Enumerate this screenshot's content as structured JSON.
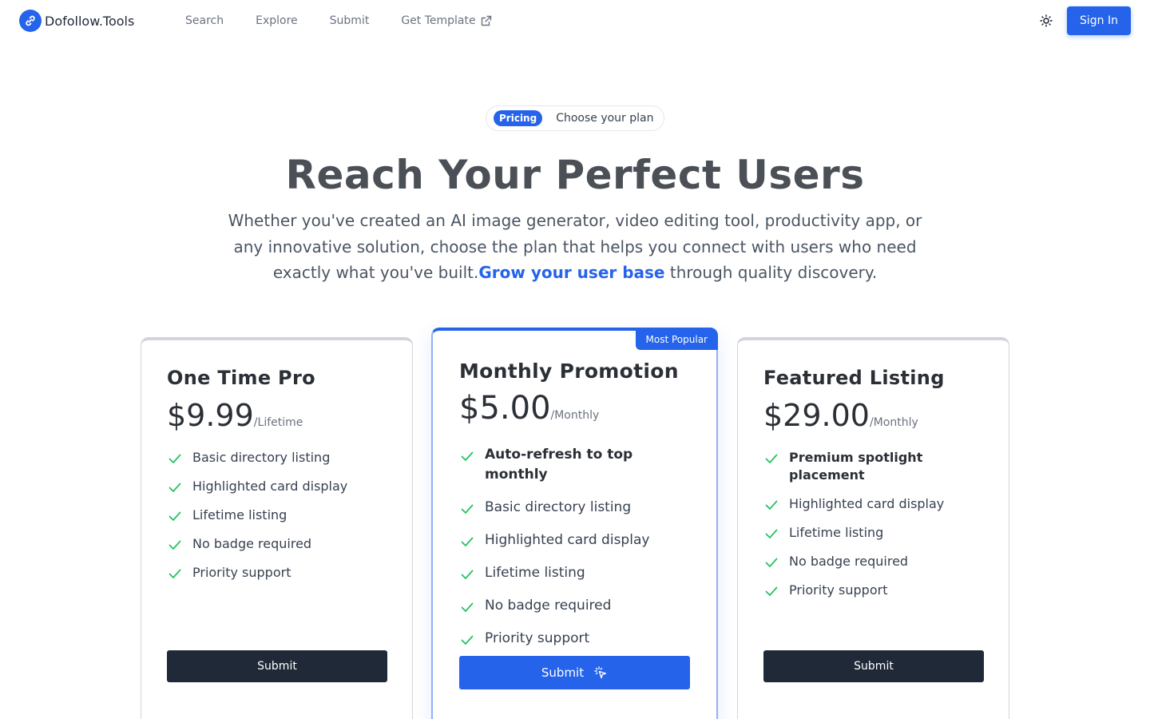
{
  "header": {
    "logo_text": "Dofollow.Tools",
    "nav": [
      {
        "label": "Search"
      },
      {
        "label": "Explore"
      },
      {
        "label": "Submit"
      },
      {
        "label": "Get Template",
        "icon": "external-link-icon"
      }
    ],
    "theme_icon": "sun-icon",
    "signin_label": "Sign In"
  },
  "hero": {
    "pill_badge": "Pricing",
    "pill_text": "Choose your plan",
    "title": "Reach Your Perfect Users",
    "subtitle_before": "Whether you've created an AI image generator, video editing tool, productivity app, or any innovative solution, choose the plan that helps you connect with users who need exactly what you've built.",
    "subtitle_highlight": "Grow your user base",
    "subtitle_after": " through quality discovery."
  },
  "plans": [
    {
      "name": "One Time Pro",
      "price": "$9.99",
      "period": "/Lifetime",
      "features": [
        "Basic directory listing",
        "Highlighted card display",
        "Lifetime listing",
        "No badge required",
        "Priority support"
      ],
      "button": "Submit"
    },
    {
      "name": "Monthly Promotion",
      "price": "$5.00",
      "period": "/Monthly",
      "badge": "Most Popular",
      "features": [
        "Auto-refresh to top monthly",
        "Basic directory listing",
        "Highlighted card display",
        "Lifetime listing",
        "No badge required",
        "Priority support"
      ],
      "button": "Submit",
      "button_icon": "pointer-click-icon"
    },
    {
      "name": "Featured Listing",
      "price": "$29.00",
      "period": "/Monthly",
      "features": [
        "Premium spotlight placement",
        "Highlighted card display",
        "Lifetime listing",
        "No badge required",
        "Priority support"
      ],
      "button": "Submit"
    }
  ],
  "colors": {
    "accent": "#2563eb",
    "dark_button": "#1f2937",
    "check": "#22c55e"
  }
}
